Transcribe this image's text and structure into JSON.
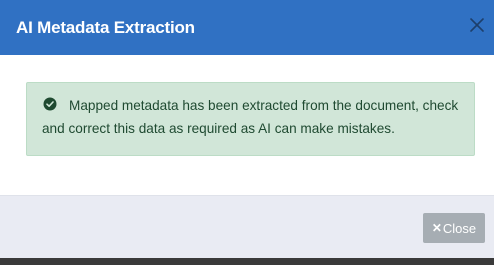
{
  "dialog": {
    "title": "AI Metadata Extraction",
    "header_close_icon": "close-icon",
    "header_color": "#3071c3"
  },
  "alert": {
    "icon": "check-circle-icon",
    "message": "Mapped metadata has been extracted from the document, check and correct this data as required as AI can make mistakes.",
    "background_color": "#d1e6d8",
    "text_color": "#1f4a31"
  },
  "footer": {
    "close_icon": "✕",
    "close_label": "Close",
    "close_button_color": "#a6adb3"
  }
}
